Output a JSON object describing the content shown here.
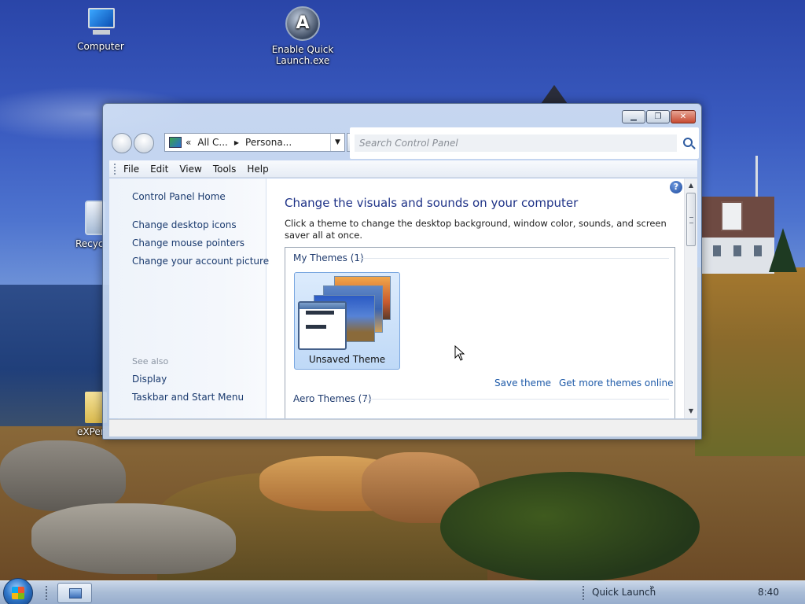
{
  "desktop": {
    "icons": {
      "computer": "Computer",
      "quick_launch": "Enable Quick Launch.exe",
      "recycle": "Recyc",
      "experience": "eXPer"
    }
  },
  "window": {
    "address": {
      "chevron": "«",
      "seg1": "All C...",
      "seg2": "Persona..."
    },
    "search_placeholder": "Search Control Panel",
    "menu": [
      "File",
      "Edit",
      "View",
      "Tools",
      "Help"
    ],
    "sidebar": {
      "home": "Control Panel Home",
      "links": [
        "Change desktop icons",
        "Change mouse pointers",
        "Change your account picture"
      ],
      "see_also": "See also",
      "see_also_links": [
        "Display",
        "Taskbar and Start Menu"
      ]
    },
    "main": {
      "title": "Change the visuals and sounds on your computer",
      "description": "Click a theme to change the desktop background, window color, sounds, and screen saver all at once.",
      "my_themes": "My Themes (1)",
      "unsaved_theme": "Unsaved Theme",
      "save_theme": "Save theme",
      "get_more": "Get more themes online",
      "aero_themes": "Aero Themes (7)"
    }
  },
  "taskbar": {
    "quick_launch": "Quick Launch",
    "quick_launch_chevron": "»",
    "clock": "8:40"
  }
}
